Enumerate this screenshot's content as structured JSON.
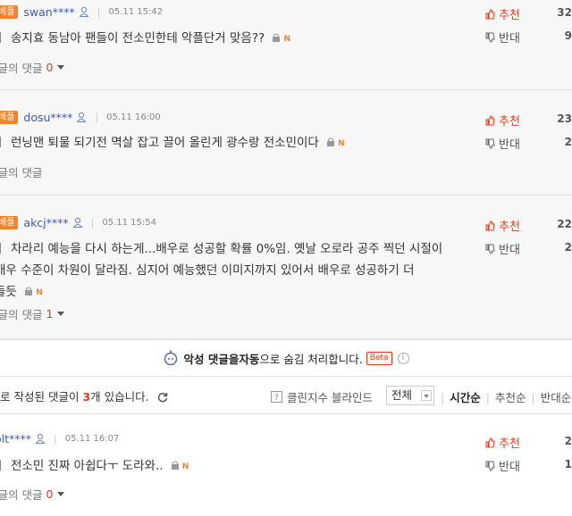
{
  "up_label": "추천",
  "down_label": "반대",
  "replies_label": "답글의 댓글",
  "best_label": "베플",
  "comments": [
    {
      "user": "swan****",
      "date": "05.11 15:42",
      "text": "송지효 동남아 팬들이 전소민한테 악플단거 맞음??",
      "replies": "0",
      "up": "32",
      "down": "9"
    },
    {
      "user": "dosu****",
      "date": "05.11 16:00",
      "text": "런닝맨 퇴물 되기전 멱살 잡고 끌어 올린게 광수랑 전소민이다",
      "replies": "",
      "up": "23",
      "down": "2"
    },
    {
      "user": "akcj****",
      "date": "05.11 15:54",
      "text_lines": [
        "차라리 예능을 다시 하는게...배우로 성공할 확률 0%임. 옛날 오로라 공주 찍던 시절이",
        "배우 수준이 차원이 달라짐. 심지어 예능했던 이미지까지 있어서 배우로 성공하기 더",
        "들듯"
      ],
      "replies": "1",
      "up": "22",
      "down": "2"
    },
    {
      "user": "olt****",
      "date": "05.11 16:07",
      "text": "전소민 진짜 아쉽다ㅜ 도라와..",
      "replies": "0",
      "up": "2",
      "down": "1"
    }
  ],
  "notice": {
    "pre": "악성 댓글을 ",
    "bold": "자동",
    "post": "으로 숨김 처리합니다.",
    "beta": "Beta",
    "info": "i"
  },
  "toolbar": {
    "count_pre": "로 작성된 댓글이 ",
    "count": "3",
    "count_post": "개 있습니다.",
    "clean_label": "클린지수 블라인드",
    "filter_value": "전체",
    "sorts": [
      "시간순",
      "추천순",
      "반대순"
    ]
  },
  "colors": {
    "accent": "#e4391c",
    "best_badge": "#f5832a",
    "username": "#3d5ab7"
  }
}
